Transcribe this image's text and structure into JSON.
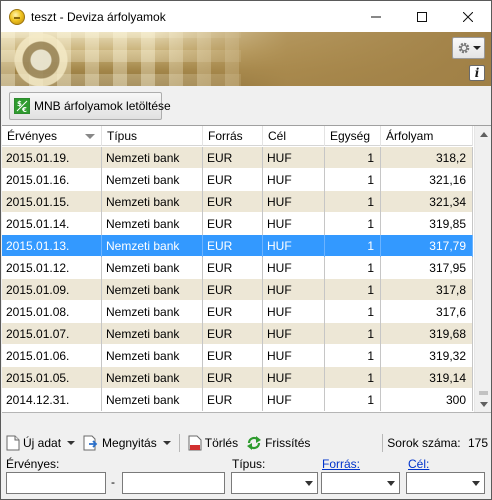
{
  "window": {
    "title": "teszt - Deviza árfolyamok",
    "minimize": "—",
    "maximize": "☐",
    "close": "✕"
  },
  "banner": {
    "settings_icon": "gear-icon",
    "info_label": "i"
  },
  "download_button": {
    "label": "MNB árfolyamok letöltése",
    "icon": "download-currency-icon"
  },
  "grid": {
    "columns": [
      "Érvényes",
      "Típus",
      "Forrás",
      "Cél",
      "Egység",
      "Árfolyam"
    ],
    "sort_column": "Érvényes",
    "sort_direction": "descending",
    "selected_row": 4,
    "rows": [
      [
        "2015.01.19.",
        "Nemzeti bank",
        "EUR",
        "HUF",
        "1",
        "318,2"
      ],
      [
        "2015.01.16.",
        "Nemzeti bank",
        "EUR",
        "HUF",
        "1",
        "321,16"
      ],
      [
        "2015.01.15.",
        "Nemzeti bank",
        "EUR",
        "HUF",
        "1",
        "321,34"
      ],
      [
        "2015.01.14.",
        "Nemzeti bank",
        "EUR",
        "HUF",
        "1",
        "319,85"
      ],
      [
        "2015.01.13.",
        "Nemzeti bank",
        "EUR",
        "HUF",
        "1",
        "317,79"
      ],
      [
        "2015.01.12.",
        "Nemzeti bank",
        "EUR",
        "HUF",
        "1",
        "317,95"
      ],
      [
        "2015.01.09.",
        "Nemzeti bank",
        "EUR",
        "HUF",
        "1",
        "317,8"
      ],
      [
        "2015.01.08.",
        "Nemzeti bank",
        "EUR",
        "HUF",
        "1",
        "317,6"
      ],
      [
        "2015.01.07.",
        "Nemzeti bank",
        "EUR",
        "HUF",
        "1",
        "319,68"
      ],
      [
        "2015.01.06.",
        "Nemzeti bank",
        "EUR",
        "HUF",
        "1",
        "319,32"
      ],
      [
        "2015.01.05.",
        "Nemzeti bank",
        "EUR",
        "HUF",
        "1",
        "319,14"
      ],
      [
        "2014.12.31.",
        "Nemzeti bank",
        "EUR",
        "HUF",
        "1",
        "300"
      ]
    ]
  },
  "toolbar": {
    "new_label": "Új adat",
    "open_label": "Megnyitás",
    "delete_label": "Törlés",
    "refresh_label": "Frissítés",
    "rows_count_label": "Sorok száma:",
    "rows_count_value": "175"
  },
  "filters": {
    "valid_label": "Érvényes:",
    "range_separator": "-",
    "from_value": "",
    "to_value": "",
    "type_label": "Típus:",
    "type_value": "",
    "source_label": "Forrás:",
    "source_value": "",
    "target_label": "Cél:",
    "target_value": ""
  },
  "colors": {
    "row_alt": "#ede7d6",
    "row_selected": "#3399ff",
    "link": "#0033cc"
  }
}
